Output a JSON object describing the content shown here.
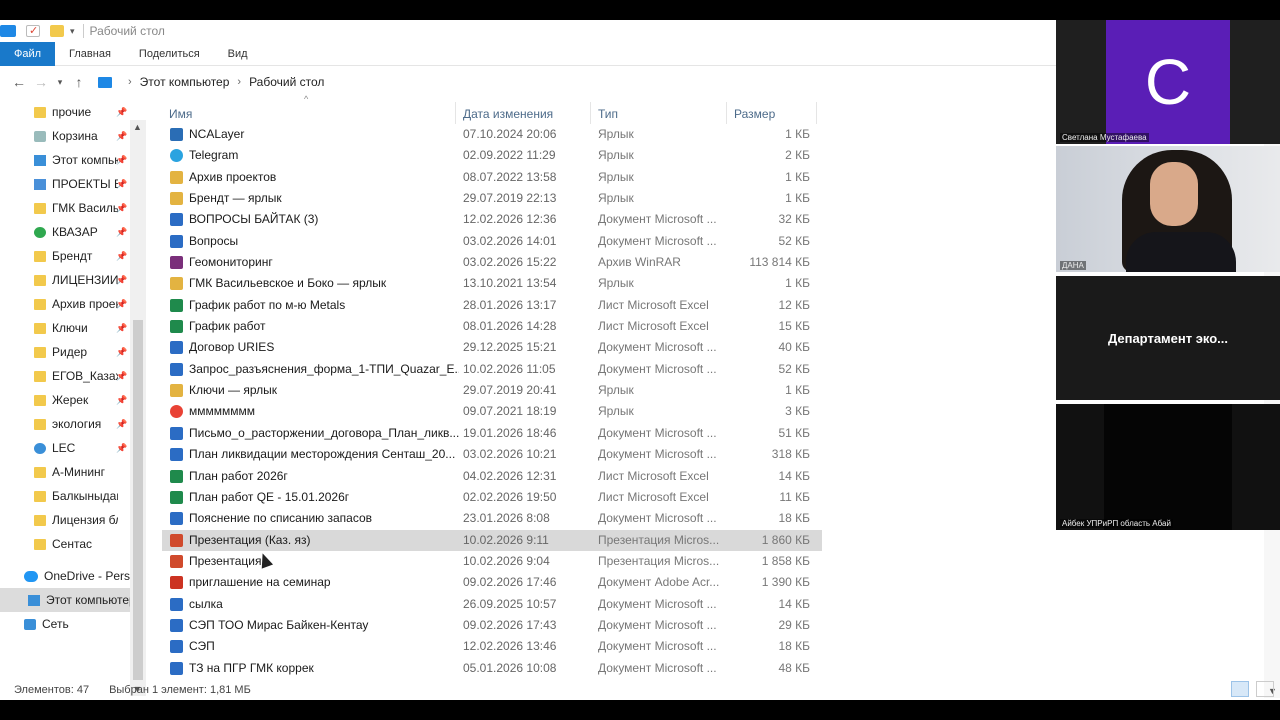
{
  "window": {
    "title": "Рабочий стол"
  },
  "ribbon": {
    "tabs": [
      "Файл",
      "Главная",
      "Поделиться",
      "Вид"
    ]
  },
  "address": {
    "crumbs": [
      "Этот компьютер",
      "Рабочий стол"
    ]
  },
  "navpane": {
    "items": [
      {
        "label": "прочие",
        "icon": "folder-icon",
        "pinned": true
      },
      {
        "label": "Корзина",
        "icon": "recycle-bin-icon",
        "pinned": true
      },
      {
        "label": "Этот компьютер",
        "icon": "computer-icon",
        "pinned": true
      },
      {
        "label": "ПРОЕКТЫ В",
        "icon": "drive-folder-icon",
        "pinned": true
      },
      {
        "label": "ГМК Васильевское",
        "icon": "link-folder-icon",
        "pinned": true
      },
      {
        "label": "КВАЗАР",
        "icon": "tree-icon",
        "pinned": true
      },
      {
        "label": "Брендт",
        "icon": "folder-icon",
        "pinned": true
      },
      {
        "label": "ЛИЦЕНЗИИ",
        "icon": "folder-icon",
        "pinned": true
      },
      {
        "label": "Архив проектов",
        "icon": "folder-icon",
        "pinned": true
      },
      {
        "label": "Ключи",
        "icon": "folder-icon",
        "pinned": true
      },
      {
        "label": "Ридер",
        "icon": "folder-icon",
        "pinned": true
      },
      {
        "label": "ЕГОВ_Казахстан",
        "icon": "folder-icon",
        "pinned": true
      },
      {
        "label": "Жерек",
        "icon": "folder-icon",
        "pinned": true
      },
      {
        "label": "экология",
        "icon": "folder-icon",
        "pinned": true
      },
      {
        "label": "LEC",
        "icon": "globe-icon",
        "pinned": true
      },
      {
        "label": "А-Мининг",
        "icon": "folder-icon",
        "pinned": false
      },
      {
        "label": "Балкыныдак",
        "icon": "folder-icon",
        "pinned": false
      },
      {
        "label": "Лицензия бло",
        "icon": "folder-icon",
        "pinned": false
      },
      {
        "label": "Сентас",
        "icon": "folder-icon",
        "pinned": false
      }
    ],
    "roots": [
      {
        "label": "OneDrive - Personal",
        "icon": "cloud-icon"
      },
      {
        "label": "Этот компьютер",
        "icon": "computer-icon"
      },
      {
        "label": "Сеть",
        "icon": "network-icon"
      }
    ]
  },
  "columns": {
    "name": "Имя",
    "date": "Дата изменения",
    "type": "Тип",
    "size": "Размер"
  },
  "files": [
    {
      "name": "NCALayer",
      "date": "07.10.2024 20:06",
      "type": "Ярлык",
      "size": "1 КБ",
      "kind": "nca"
    },
    {
      "name": "Telegram",
      "date": "02.09.2022 11:29",
      "type": "Ярлык",
      "size": "2 КБ",
      "kind": "tg"
    },
    {
      "name": "Архив проектов",
      "date": "08.07.2022 13:58",
      "type": "Ярлык",
      "size": "1 КБ",
      "kind": "link"
    },
    {
      "name": "Брендт — ярлык",
      "date": "29.07.2019 22:13",
      "type": "Ярлык",
      "size": "1 КБ",
      "kind": "link"
    },
    {
      "name": "ВОПРОСЫ БАЙТАК (3)",
      "date": "12.02.2026 12:36",
      "type": "Документ Microsoft ...",
      "size": "32 КБ",
      "kind": "word"
    },
    {
      "name": "Вопросы",
      "date": "03.02.2026 14:01",
      "type": "Документ Microsoft ...",
      "size": "52 КБ",
      "kind": "word"
    },
    {
      "name": "Геомониторинг",
      "date": "03.02.2026 15:22",
      "type": "Архив WinRAR",
      "size": "113 814 КБ",
      "kind": "rar"
    },
    {
      "name": "ГМК Васильевское и Боко — ярлык",
      "date": "13.10.2021 13:54",
      "type": "Ярлык",
      "size": "1 КБ",
      "kind": "link"
    },
    {
      "name": "График работ по м-ю Metals",
      "date": "28.01.2026 13:17",
      "type": "Лист Microsoft Excel",
      "size": "12 КБ",
      "kind": "excel"
    },
    {
      "name": "График работ",
      "date": "08.01.2026 14:28",
      "type": "Лист Microsoft Excel",
      "size": "15 КБ",
      "kind": "excel"
    },
    {
      "name": "Договор URIES",
      "date": "29.12.2025 15:21",
      "type": "Документ Microsoft ...",
      "size": "40 КБ",
      "kind": "word"
    },
    {
      "name": "Запрос_разъяснения_форма_1-ТПИ_Quazar_E...",
      "date": "10.02.2026 11:05",
      "type": "Документ Microsoft ...",
      "size": "52 КБ",
      "kind": "word"
    },
    {
      "name": "Ключи — ярлык",
      "date": "29.07.2019 20:41",
      "type": "Ярлык",
      "size": "1 КБ",
      "kind": "link"
    },
    {
      "name": "мммммммм",
      "date": "09.07.2021 18:19",
      "type": "Ярлык",
      "size": "3 КБ",
      "kind": "chrome"
    },
    {
      "name": "Письмо_о_расторжении_договора_План_ликв...",
      "date": "19.01.2026 18:46",
      "type": "Документ Microsoft ...",
      "size": "51 КБ",
      "kind": "word"
    },
    {
      "name": "План ликвидации месторождения Сенташ_20...",
      "date": "03.02.2026 10:21",
      "type": "Документ Microsoft ...",
      "size": "318 КБ",
      "kind": "word"
    },
    {
      "name": "План работ 2026г",
      "date": "04.02.2026 12:31",
      "type": "Лист Microsoft Excel",
      "size": "14 КБ",
      "kind": "excel"
    },
    {
      "name": "План работ QE - 15.01.2026г",
      "date": "02.02.2026 19:50",
      "type": "Лист Microsoft Excel",
      "size": "11 КБ",
      "kind": "excel"
    },
    {
      "name": "Пояснение по списанию запасов",
      "date": "23.01.2026 8:08",
      "type": "Документ Microsoft ...",
      "size": "18 КБ",
      "kind": "word"
    },
    {
      "name": "Презентация (Каз. яз)",
      "date": "10.02.2026 9:11",
      "type": "Презентация Micros...",
      "size": "1 860 КБ",
      "kind": "ppt",
      "selected": true
    },
    {
      "name": "Презентация",
      "date": "10.02.2026 9:04",
      "type": "Презентация Micros...",
      "size": "1 858 КБ",
      "kind": "ppt"
    },
    {
      "name": "приглашение на семинар",
      "date": "09.02.2026 17:46",
      "type": "Документ Adobe Acr...",
      "size": "1 390 КБ",
      "kind": "pdf"
    },
    {
      "name": "сылка",
      "date": "26.09.2025 10:57",
      "type": "Документ Microsoft ...",
      "size": "14 КБ",
      "kind": "word"
    },
    {
      "name": "СЭП ТОО Мирас Байкен-Кентау",
      "date": "09.02.2026 17:43",
      "type": "Документ Microsoft ...",
      "size": "29 КБ",
      "kind": "word"
    },
    {
      "name": "СЭП",
      "date": "12.02.2026 13:46",
      "type": "Документ Microsoft ...",
      "size": "18 КБ",
      "kind": "word"
    },
    {
      "name": "ТЗ на ПГР ГМК коррек",
      "date": "05.01.2026 10:08",
      "type": "Документ Microsoft ...",
      "size": "48 КБ",
      "kind": "word"
    }
  ],
  "status": {
    "count": "Элементов: 47",
    "selection": "Выбран 1 элемент: 1,81 МБ"
  },
  "participants": [
    {
      "name": "Светлана Мустафаева",
      "avatar_letter": "С",
      "avatar_color": "#5a1eb6"
    },
    {
      "name": "ДАНА"
    },
    {
      "name": "Департамент эко..."
    },
    {
      "name": "Айбек УПРиРП область Абай"
    }
  ]
}
